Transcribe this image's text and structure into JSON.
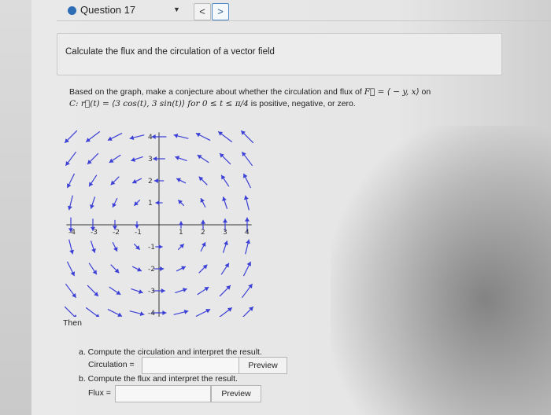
{
  "header": {
    "question_label": "Question 17",
    "prev_label": "<",
    "next_label": ">"
  },
  "title": "Calculate the flux and the circulation of a vector field",
  "prompt": {
    "line1_a": "Based on the graph, make a conjecture about whether the circulation and flux of ",
    "field_expr": "F⃗ = ⟨ − y, x⟩",
    "line1_b": " on",
    "curve_expr": "C: r⃗(t) = ⟨3 cos(t), 3 sin(t)⟩ for 0 ≤ t ≤ π/4",
    "line2_b": " is positive, negative, or zero."
  },
  "graph": {
    "x_ticks": [
      "-4",
      "-3",
      "-2",
      "-1",
      "1",
      "2",
      "3",
      "4"
    ],
    "y_ticks": [
      "4",
      "3",
      "2",
      "1",
      "-1",
      "-2",
      "-3",
      "-4"
    ],
    "vector_field": "⟨ − y, x⟩",
    "arrow_color": "#3b3fd6"
  },
  "then_label": "Then",
  "part_a": {
    "text": "a. Compute the circulation and interpret the result.",
    "field_label": "Circulation =",
    "value": "",
    "preview_label": "Preview"
  },
  "part_b": {
    "text": "b. Compute the flux and interpret the result.",
    "field_label": "Flux =",
    "value": "",
    "preview_label": "Preview"
  }
}
